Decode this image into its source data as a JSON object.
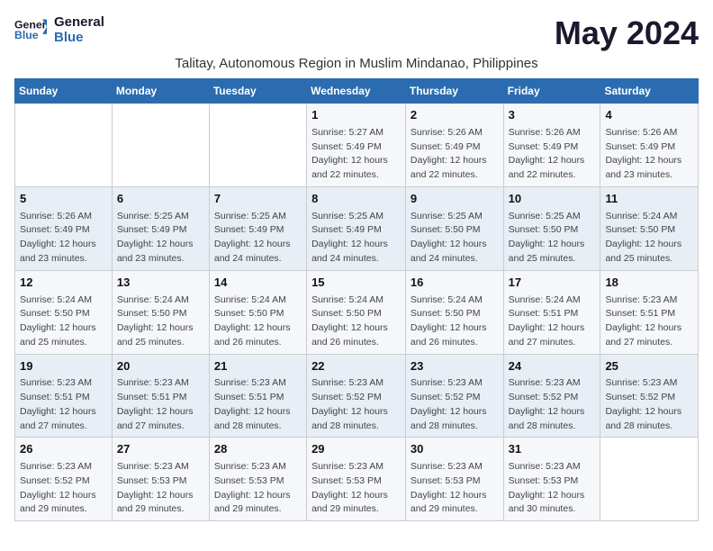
{
  "header": {
    "logo_line1": "General",
    "logo_line2": "Blue",
    "month_title": "May 2024",
    "location": "Talitay, Autonomous Region in Muslim Mindanao, Philippines"
  },
  "weekdays": [
    "Sunday",
    "Monday",
    "Tuesday",
    "Wednesday",
    "Thursday",
    "Friday",
    "Saturday"
  ],
  "weeks": [
    [
      {
        "day": "",
        "info": ""
      },
      {
        "day": "",
        "info": ""
      },
      {
        "day": "",
        "info": ""
      },
      {
        "day": "1",
        "info": "Sunrise: 5:27 AM\nSunset: 5:49 PM\nDaylight: 12 hours\nand 22 minutes."
      },
      {
        "day": "2",
        "info": "Sunrise: 5:26 AM\nSunset: 5:49 PM\nDaylight: 12 hours\nand 22 minutes."
      },
      {
        "day": "3",
        "info": "Sunrise: 5:26 AM\nSunset: 5:49 PM\nDaylight: 12 hours\nand 22 minutes."
      },
      {
        "day": "4",
        "info": "Sunrise: 5:26 AM\nSunset: 5:49 PM\nDaylight: 12 hours\nand 23 minutes."
      }
    ],
    [
      {
        "day": "5",
        "info": "Sunrise: 5:26 AM\nSunset: 5:49 PM\nDaylight: 12 hours\nand 23 minutes."
      },
      {
        "day": "6",
        "info": "Sunrise: 5:25 AM\nSunset: 5:49 PM\nDaylight: 12 hours\nand 23 minutes."
      },
      {
        "day": "7",
        "info": "Sunrise: 5:25 AM\nSunset: 5:49 PM\nDaylight: 12 hours\nand 24 minutes."
      },
      {
        "day": "8",
        "info": "Sunrise: 5:25 AM\nSunset: 5:49 PM\nDaylight: 12 hours\nand 24 minutes."
      },
      {
        "day": "9",
        "info": "Sunrise: 5:25 AM\nSunset: 5:50 PM\nDaylight: 12 hours\nand 24 minutes."
      },
      {
        "day": "10",
        "info": "Sunrise: 5:25 AM\nSunset: 5:50 PM\nDaylight: 12 hours\nand 25 minutes."
      },
      {
        "day": "11",
        "info": "Sunrise: 5:24 AM\nSunset: 5:50 PM\nDaylight: 12 hours\nand 25 minutes."
      }
    ],
    [
      {
        "day": "12",
        "info": "Sunrise: 5:24 AM\nSunset: 5:50 PM\nDaylight: 12 hours\nand 25 minutes."
      },
      {
        "day": "13",
        "info": "Sunrise: 5:24 AM\nSunset: 5:50 PM\nDaylight: 12 hours\nand 25 minutes."
      },
      {
        "day": "14",
        "info": "Sunrise: 5:24 AM\nSunset: 5:50 PM\nDaylight: 12 hours\nand 26 minutes."
      },
      {
        "day": "15",
        "info": "Sunrise: 5:24 AM\nSunset: 5:50 PM\nDaylight: 12 hours\nand 26 minutes."
      },
      {
        "day": "16",
        "info": "Sunrise: 5:24 AM\nSunset: 5:50 PM\nDaylight: 12 hours\nand 26 minutes."
      },
      {
        "day": "17",
        "info": "Sunrise: 5:24 AM\nSunset: 5:51 PM\nDaylight: 12 hours\nand 27 minutes."
      },
      {
        "day": "18",
        "info": "Sunrise: 5:23 AM\nSunset: 5:51 PM\nDaylight: 12 hours\nand 27 minutes."
      }
    ],
    [
      {
        "day": "19",
        "info": "Sunrise: 5:23 AM\nSunset: 5:51 PM\nDaylight: 12 hours\nand 27 minutes."
      },
      {
        "day": "20",
        "info": "Sunrise: 5:23 AM\nSunset: 5:51 PM\nDaylight: 12 hours\nand 27 minutes."
      },
      {
        "day": "21",
        "info": "Sunrise: 5:23 AM\nSunset: 5:51 PM\nDaylight: 12 hours\nand 28 minutes."
      },
      {
        "day": "22",
        "info": "Sunrise: 5:23 AM\nSunset: 5:52 PM\nDaylight: 12 hours\nand 28 minutes."
      },
      {
        "day": "23",
        "info": "Sunrise: 5:23 AM\nSunset: 5:52 PM\nDaylight: 12 hours\nand 28 minutes."
      },
      {
        "day": "24",
        "info": "Sunrise: 5:23 AM\nSunset: 5:52 PM\nDaylight: 12 hours\nand 28 minutes."
      },
      {
        "day": "25",
        "info": "Sunrise: 5:23 AM\nSunset: 5:52 PM\nDaylight: 12 hours\nand 28 minutes."
      }
    ],
    [
      {
        "day": "26",
        "info": "Sunrise: 5:23 AM\nSunset: 5:52 PM\nDaylight: 12 hours\nand 29 minutes."
      },
      {
        "day": "27",
        "info": "Sunrise: 5:23 AM\nSunset: 5:53 PM\nDaylight: 12 hours\nand 29 minutes."
      },
      {
        "day": "28",
        "info": "Sunrise: 5:23 AM\nSunset: 5:53 PM\nDaylight: 12 hours\nand 29 minutes."
      },
      {
        "day": "29",
        "info": "Sunrise: 5:23 AM\nSunset: 5:53 PM\nDaylight: 12 hours\nand 29 minutes."
      },
      {
        "day": "30",
        "info": "Sunrise: 5:23 AM\nSunset: 5:53 PM\nDaylight: 12 hours\nand 29 minutes."
      },
      {
        "day": "31",
        "info": "Sunrise: 5:23 AM\nSunset: 5:53 PM\nDaylight: 12 hours\nand 30 minutes."
      },
      {
        "day": "",
        "info": ""
      }
    ]
  ]
}
